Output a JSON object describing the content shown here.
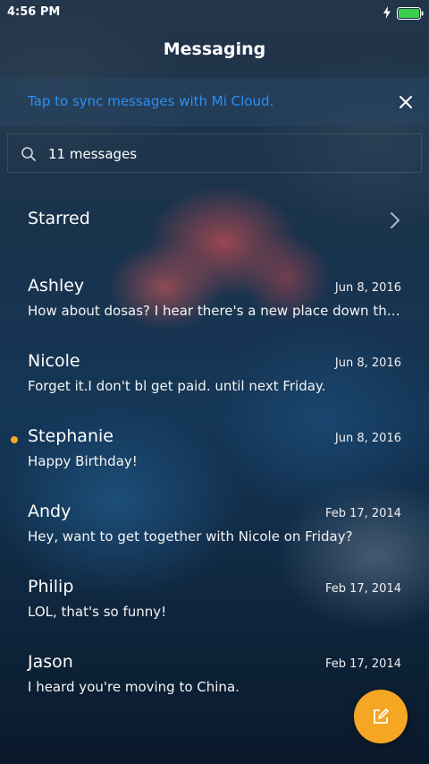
{
  "status_bar": {
    "time": "4:56 PM",
    "battery_color": "#3ccf4e"
  },
  "header": {
    "title": "Messaging"
  },
  "sync_banner": {
    "text": "Tap to sync messages with Mi Cloud.",
    "text_color": "#2c8ff0",
    "close_icon": "close-icon"
  },
  "search": {
    "text": "11 messages",
    "icon": "search-icon"
  },
  "starred": {
    "label": "Starred",
    "icon": "chevron-right-icon"
  },
  "threads": [
    {
      "name": "Ashley",
      "date": "Jun 8, 2016",
      "snippet": "How about dosas? I hear there's a new place down the st…",
      "unread": false
    },
    {
      "name": "Nicole",
      "date": "Jun 8, 2016",
      "snippet": "Forget it.I don't bl get paid. until next Friday.",
      "unread": false
    },
    {
      "name": "Stephanie",
      "date": "Jun 8, 2016",
      "snippet": "Happy Birthday!",
      "unread": true
    },
    {
      "name": "Andy",
      "date": "Feb 17, 2014",
      "snippet": "Hey, want to get together with Nicole on Friday?",
      "unread": false
    },
    {
      "name": "Philip",
      "date": "Feb 17, 2014",
      "snippet": "LOL, that's so funny!",
      "unread": false
    },
    {
      "name": "Jason",
      "date": "Feb 17, 2014",
      "snippet": "I heard you're moving to China.",
      "unread": false
    }
  ],
  "fab": {
    "icon": "compose-icon",
    "color": "#f5a623"
  },
  "accent_unread_color": "#f5a623"
}
